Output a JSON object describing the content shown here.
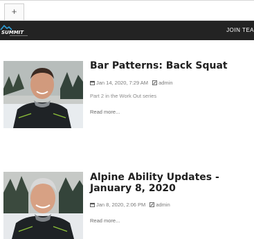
{
  "browser": {
    "new_tab_label": "+"
  },
  "header": {
    "logo_text": "SUMMIT",
    "nav_cta": "JOIN TEA"
  },
  "posts": [
    {
      "title": "Bar Patterns: Back Squat",
      "date": "Jan 14, 2020, 7:29 AM",
      "author": "admin",
      "excerpt": "Part 2 in the Work Out series",
      "read_more": "Read more..."
    },
    {
      "title": "Alpine Ability Updates - January 8, 2020",
      "date": "Jan 8, 2020, 2:06 PM",
      "author": "admin",
      "excerpt": "",
      "read_more": "Read more..."
    }
  ],
  "icons": {
    "calendar": "calendar-icon",
    "author": "edit-icon"
  }
}
